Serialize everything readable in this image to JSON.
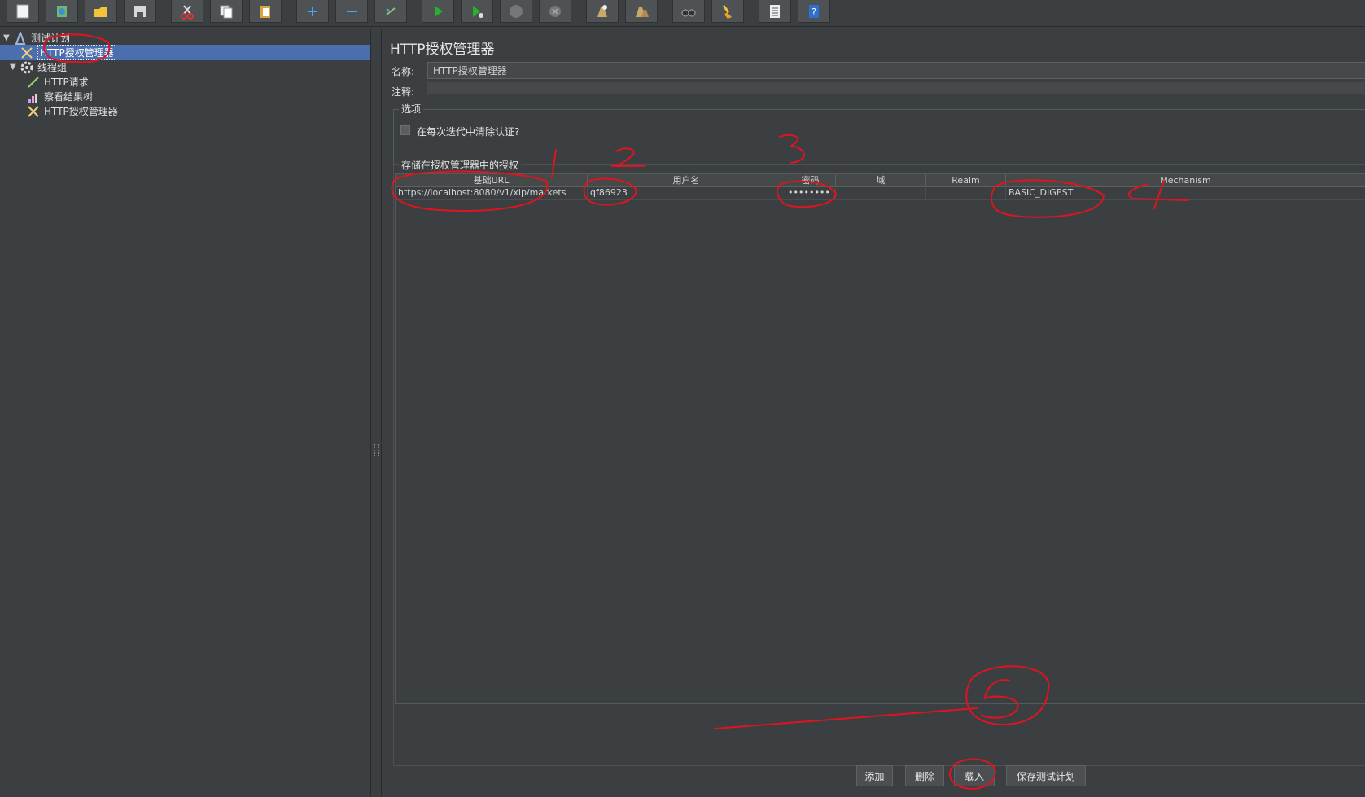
{
  "toolbar": {
    "buttons": [
      {
        "id": "new",
        "icon": "new-file-icon"
      },
      {
        "id": "templates",
        "icon": "templates-icon"
      },
      {
        "id": "open",
        "icon": "open-folder-icon"
      },
      {
        "id": "save",
        "icon": "save-icon"
      },
      {
        "id": "cut",
        "icon": "cut-icon"
      },
      {
        "id": "copy",
        "icon": "copy-icon"
      },
      {
        "id": "paste",
        "icon": "paste-icon"
      },
      {
        "id": "expand",
        "icon": "plus-icon"
      },
      {
        "id": "collapse",
        "icon": "minus-icon"
      },
      {
        "id": "toggle",
        "icon": "toggle-icon"
      },
      {
        "id": "start",
        "icon": "play-icon"
      },
      {
        "id": "start-no-pause",
        "icon": "play-no-timer-icon"
      },
      {
        "id": "stop",
        "icon": "stop-icon"
      },
      {
        "id": "shutdown",
        "icon": "shutdown-icon"
      },
      {
        "id": "clear",
        "icon": "clear-icon"
      },
      {
        "id": "clear-all",
        "icon": "clear-all-icon"
      },
      {
        "id": "search",
        "icon": "binoculars-icon"
      },
      {
        "id": "reset-search",
        "icon": "broom-icon"
      },
      {
        "id": "function-helper",
        "icon": "list-icon"
      },
      {
        "id": "help",
        "icon": "help-icon"
      }
    ]
  },
  "tree": {
    "items": [
      {
        "label": "测试计划",
        "icon": "test-plan-icon",
        "level": 0,
        "expanded": true,
        "selected": false
      },
      {
        "label": "HTTP授权管理器",
        "icon": "auth-manager-icon",
        "level": 1,
        "expanded": null,
        "selected": true
      },
      {
        "label": "线程组",
        "icon": "thread-group-gear-icon",
        "level": 1,
        "expanded": true,
        "selected": false
      },
      {
        "label": "HTTP请求",
        "icon": "http-request-icon",
        "level": 2,
        "expanded": null,
        "selected": false
      },
      {
        "label": "察看结果树",
        "icon": "results-tree-icon",
        "level": 2,
        "expanded": null,
        "selected": false
      },
      {
        "label": "HTTP授权管理器",
        "icon": "auth-manager-icon",
        "level": 2,
        "expanded": null,
        "selected": false
      }
    ]
  },
  "panel": {
    "title": "HTTP授权管理器",
    "name_label": "名称:",
    "name_value": "HTTP授权管理器",
    "comment_label": "注释:",
    "options_title": "选项",
    "clear_each_iteration_label": "在每次迭代中清除认证?",
    "clear_each_iteration_checked": false,
    "stored_title": "存储在授权管理器中的授权"
  },
  "table": {
    "columns": [
      "基础URL",
      "用户名",
      "密码",
      "域",
      "Realm",
      "Mechanism"
    ],
    "rows": [
      {
        "base_url": "https://localhost:8080/v1/xip/markets",
        "username": "qf86923",
        "password": "••••••••",
        "domain": "",
        "realm": "",
        "mechanism": "BASIC_DIGEST"
      }
    ]
  },
  "buttons": {
    "add": "添加",
    "delete": "删除",
    "load": "载入",
    "save_plan": "保存测试计划"
  },
  "annotations": {
    "color": "#e0141e",
    "labels": [
      "1",
      "2",
      "3",
      "4",
      "5"
    ]
  }
}
